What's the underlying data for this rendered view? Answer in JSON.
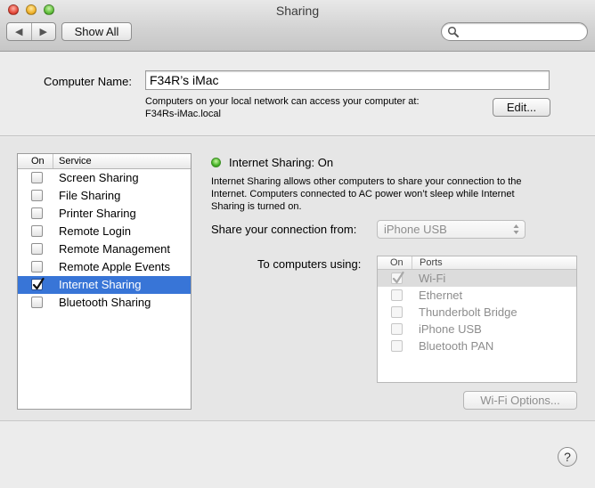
{
  "window": {
    "title": "Sharing"
  },
  "toolbar": {
    "back_glyph": "◀",
    "forward_glyph": "▶",
    "show_all_label": "Show All",
    "search_placeholder": ""
  },
  "computer": {
    "name_label": "Computer Name:",
    "name_value": "F34R’s iMac",
    "access_line1": "Computers on your local network can access your computer at:",
    "access_line2": "F34Rs-iMac.local",
    "edit_label": "Edit..."
  },
  "services": {
    "header_on": "On",
    "header_service": "Service",
    "items": [
      {
        "label": "Screen Sharing",
        "checked": false,
        "selected": false
      },
      {
        "label": "File Sharing",
        "checked": false,
        "selected": false
      },
      {
        "label": "Printer Sharing",
        "checked": false,
        "selected": false
      },
      {
        "label": "Remote Login",
        "checked": false,
        "selected": false
      },
      {
        "label": "Remote Management",
        "checked": false,
        "selected": false
      },
      {
        "label": "Remote Apple Events",
        "checked": false,
        "selected": false
      },
      {
        "label": "Internet Sharing",
        "checked": true,
        "selected": true
      },
      {
        "label": "Bluetooth Sharing",
        "checked": false,
        "selected": false
      }
    ]
  },
  "detail": {
    "status_title": "Internet Sharing: On",
    "status_color": "#47b529",
    "description_line1": "Internet Sharing allows other computers to share your connection to the",
    "description_line2": "Internet. Computers connected to AC power won’t sleep while Internet",
    "description_line3": "Sharing is turned on.",
    "share_from_label": "Share your connection from:",
    "share_from_value": "iPhone USB",
    "to_computers_label": "To computers using:",
    "ports_header_on": "On",
    "ports_header_ports": "Ports",
    "ports": [
      {
        "label": "Wi-Fi",
        "checked": true,
        "selected": true
      },
      {
        "label": "Ethernet",
        "checked": false,
        "selected": false
      },
      {
        "label": "Thunderbolt Bridge",
        "checked": false,
        "selected": false
      },
      {
        "label": "iPhone USB",
        "checked": false,
        "selected": false
      },
      {
        "label": "Bluetooth PAN",
        "checked": false,
        "selected": false
      }
    ],
    "wifi_options_label": "Wi-Fi Options..."
  },
  "help": {
    "label": "?"
  },
  "colors": {
    "selection": "#3875d7",
    "disabled_text": "#8d8d8d"
  }
}
